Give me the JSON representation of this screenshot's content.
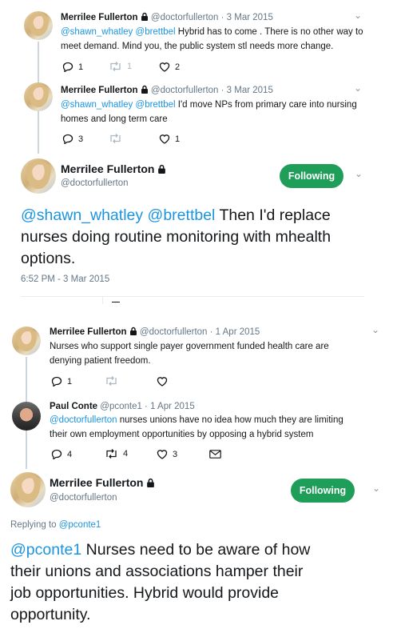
{
  "top": {
    "t1": {
      "name": "Merrilee Fullerton",
      "handle_date": "@doctorfullerton · 3 Mar 2015",
      "mention1": "@shawn_whatley",
      "mention2": "@brettbel",
      "text_line1_rest": " Hybrid has to come . There is no other way to",
      "text_line2": "meet demand. Mind you, the public system stl needs more change.",
      "reply_count": "1",
      "retweet_count": "1",
      "like_count": "2"
    },
    "t2": {
      "name": "Merrilee Fullerton",
      "handle_date": "@doctorfullerton · 3 Mar 2015",
      "mention1": "@shawn_whatley",
      "mention2": "@brettbel",
      "text_line1_rest": " I'd move NPs from primary care into nursing",
      "text_line2": "homes and long term care",
      "reply_count": "3",
      "like_count": "1"
    },
    "main": {
      "name": "Merrilee Fullerton",
      "handle": "@doctorfullerton",
      "follow_label": "Following",
      "mention1": "@shawn_whatley",
      "mention2": "@brettbel",
      "line1_rest": " Then I'd replace",
      "line2": "nurses doing routine monitoring with mhealth",
      "line3": "options.",
      "timestamp": "6:52 PM - 3 Mar 2015"
    }
  },
  "bottom": {
    "t1": {
      "name": "Merrilee Fullerton",
      "handle_date": "@doctorfullerton · 1 Apr 2015",
      "line1": "Nurses who support single payer government funded health care are",
      "line2": "denying patient freedom.",
      "reply_count": "1"
    },
    "t2": {
      "name": "Paul Conte",
      "handle_date": "@pconte1 · 1 Apr 2015",
      "mention": "@doctorfullerton",
      "line1_rest": " nurses unions have no idea how much they are limiting",
      "line2": "their own employment opportunities by opposing a hybrid system",
      "reply_count": "4",
      "retweet_count": "4",
      "like_count": "3"
    },
    "main": {
      "name": "Merrilee Fullerton",
      "handle": "@doctorfullerton",
      "follow_label": "Following",
      "replying_prefix": "Replying to ",
      "replying_handle": "@pconte1",
      "mention": "@pconte1",
      "line1_rest": " Nurses need to be aware of how",
      "line2": "their unions and associations hamper their",
      "line3": "job opportunities. Hybrid would provide",
      "line4": "opportunity."
    }
  },
  "colors": {
    "follow_green": "#1e9e58",
    "link_blue": "#1b95e0",
    "muted_gray": "#657786"
  }
}
